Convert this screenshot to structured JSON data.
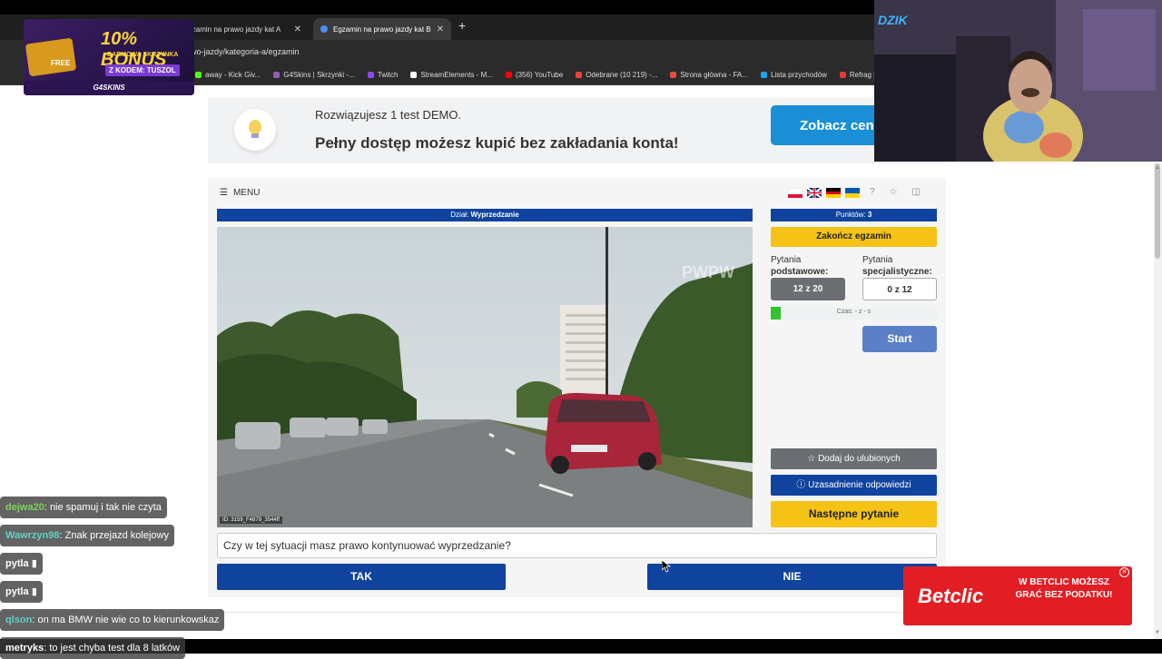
{
  "browser": {
    "tabs": [
      {
        "label": "Egzamin na prawo jazdy kat A"
      },
      {
        "label": "Egzamin na prawo jazdy kat B"
      }
    ],
    "new_tab": "+",
    "url": "wo-jazdy/kategoria-a/egzamin",
    "bookmarks": [
      {
        "label": "away - Kick Giv...",
        "color": "#53fc18"
      },
      {
        "label": "G4Skins | Skrzynki -...",
        "color": "#9b59b6"
      },
      {
        "label": "Twitch",
        "color": "#9146ff"
      },
      {
        "label": "StreamElements - M...",
        "color": "#ffffff"
      },
      {
        "label": "(356) YouTube",
        "color": "#ff0000"
      },
      {
        "label": "Odebrane (10 219) -...",
        "color": "#ea4335"
      },
      {
        "label": "Strona główna - FA...",
        "color": "#e74c3c"
      },
      {
        "label": "Lista przychodów",
        "color": "#1da1f2"
      },
      {
        "label": "Refrag | D",
        "color": "#e53935"
      }
    ]
  },
  "promo": {
    "line1": "Rozwiązujesz 1 test DEMO.",
    "line2": "Pełny dostęp możesz kupić bez zakładania konta!",
    "button": "Zobacz cen"
  },
  "exam": {
    "menu_label": "MENU",
    "section_prefix": "Dział:",
    "section_name": "Wyprzedzanie",
    "points_prefix": "Punktów:",
    "points_value": "3",
    "finish_button": "Zakończ egzamin",
    "basic_label_1": "Pytania",
    "basic_label_2": "podstawowe",
    "basic_count": "12 z 20",
    "special_label_1": "Pytania",
    "special_label_2": "specjalistyczne",
    "special_count": "0 z 12",
    "time_text": "Czas: - z - s",
    "time_progress": 0.06,
    "start_button": "Start",
    "fav_button": "Dodaj do ulubionych",
    "reason_button": "Uzasadnienie odpowiedzi",
    "next_button": "Następne pytanie",
    "question": "Czy w tej sytuacji masz prawo kontynuować wyprzedzanie?",
    "answer_yes": "TAK",
    "answer_no": "NIE",
    "video_id": "ID: 3159_F4879_3544ff",
    "video_watermark": "PWPW"
  },
  "g4skins": {
    "free": "FREE",
    "bonus": "10% BONUS",
    "chest": "+DARMOWA SKRZYNKA",
    "code": "Z KODEM: TUSZOL",
    "logo": "G4SKINS"
  },
  "webcam": {
    "brand": "DZIK"
  },
  "chat": [
    {
      "user": "dejwa20",
      "text": "nie spamuj i tak nie czyta",
      "color": "#7fd35a"
    },
    {
      "user": "Wawrzyn98",
      "text": "Znak przejazd kolejowy",
      "color": "#5fd3c5"
    },
    {
      "user": "pytla",
      "text": "",
      "color": "#ffffff"
    },
    {
      "user": "pytla",
      "text": "",
      "color": "#ffffff"
    },
    {
      "user": "qlson",
      "text": "on ma BMW nie wie co to kierunkowskaz",
      "color": "#5fd3c5"
    },
    {
      "user": "metryks",
      "text": "to jest chyba test dla 8 latków",
      "color": "#ffffff"
    }
  ],
  "betclic": {
    "logo": "Betclic",
    "text": "W BETCLIC MOŻESZ GRAĆ BEZ PODATKU!"
  }
}
